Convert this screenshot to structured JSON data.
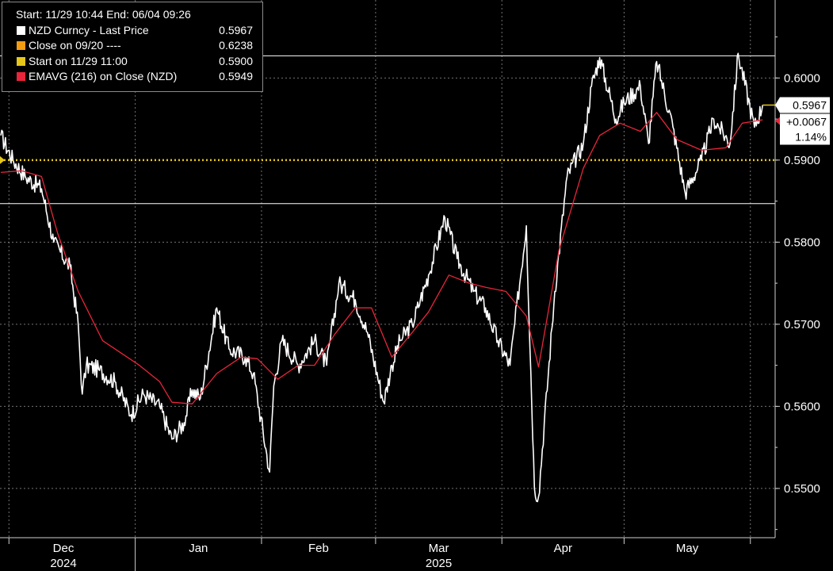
{
  "legend": {
    "header": "Start: 11/29 10:44 End: 06/04 09:26",
    "items": [
      {
        "label": "NZD Curncy - Last Price",
        "value": "0.5967",
        "color": "#ffffff"
      },
      {
        "label": "Close on 09/20 ----",
        "value": "0.6238",
        "color": "#f39c12"
      },
      {
        "label": "Start on 11/29 11:00",
        "value": "0.5900",
        "color": "#e6c619"
      },
      {
        "label": "EMAVG (216)  on Close (NZD)",
        "value": "0.5949",
        "color": "#e8253a"
      }
    ]
  },
  "last_box": {
    "price": "0.5967",
    "change": "+0.0067",
    "pct": "1.14%"
  },
  "chart_data": {
    "type": "line",
    "title": "",
    "ylim": [
      0.544,
      0.6095
    ],
    "y_ticks": [
      "0.5500",
      "0.5600",
      "0.5700",
      "0.5800",
      "0.5900",
      "0.6000"
    ],
    "x_months": [
      {
        "label": "Dec",
        "year": "2024"
      },
      {
        "label": "Jan",
        "year": ""
      },
      {
        "label": "Feb",
        "year": ""
      },
      {
        "label": "Mar",
        "year": "2025"
      },
      {
        "label": "Apr",
        "year": ""
      },
      {
        "label": "May",
        "year": ""
      }
    ],
    "hlines": [
      {
        "name": "upper_level",
        "value": 0.6027,
        "color": "#ffffff",
        "style": "solid"
      },
      {
        "name": "Start on 11/29 11:00",
        "value": 0.59,
        "color": "#e6c619",
        "style": "dotted"
      },
      {
        "name": "lower_level",
        "value": 0.5847,
        "color": "#ffffff",
        "style": "solid"
      }
    ],
    "series": [
      {
        "name": "NZD Curncy - Last Price",
        "color": "#ffffff",
        "x": [
          "11/29",
          "12/02",
          "12/05",
          "12/09",
          "12/12",
          "12/16",
          "12/18",
          "12/19",
          "12/20",
          "12/23",
          "12/27",
          "12/31",
          "01/03",
          "01/07",
          "01/10",
          "01/13",
          "01/15",
          "01/17",
          "01/21",
          "01/24",
          "01/28",
          "01/30",
          "02/03",
          "02/04",
          "02/06",
          "02/10",
          "02/14",
          "02/17",
          "02/20",
          "02/24",
          "02/27",
          "03/03",
          "03/05",
          "03/07",
          "03/10",
          "03/12",
          "03/14",
          "03/18",
          "03/21",
          "03/25",
          "03/28",
          "03/31",
          "04/03",
          "04/07",
          "04/09",
          "04/10",
          "04/14",
          "04/17",
          "04/21",
          "04/23",
          "04/25",
          "04/29",
          "05/01",
          "05/05",
          "05/07",
          "05/09",
          "05/13",
          "05/16",
          "05/20",
          "05/23",
          "05/27",
          "05/29",
          "06/02",
          "06/04"
        ],
        "values": [
          0.593,
          0.59,
          0.588,
          0.5865,
          0.58,
          0.577,
          0.57,
          0.5615,
          0.565,
          0.5645,
          0.563,
          0.559,
          0.5615,
          0.56,
          0.556,
          0.558,
          0.562,
          0.561,
          0.572,
          0.567,
          0.566,
          0.564,
          0.552,
          0.5625,
          0.568,
          0.565,
          0.568,
          0.565,
          0.575,
          0.573,
          0.569,
          0.5605,
          0.565,
          0.568,
          0.57,
          0.573,
          0.576,
          0.583,
          0.578,
          0.574,
          0.572,
          0.568,
          0.565,
          0.582,
          0.55,
          0.549,
          0.574,
          0.588,
          0.592,
          0.599,
          0.6025,
          0.595,
          0.597,
          0.599,
          0.592,
          0.602,
          0.594,
          0.586,
          0.59,
          0.595,
          0.592,
          0.603,
          0.594,
          0.5967
        ]
      },
      {
        "name": "EMAVG (216)  on Close (NZD)",
        "color": "#e8253a",
        "x": [
          "11/29",
          "12/04",
          "12/09",
          "12/13",
          "12/18",
          "12/24",
          "01/02",
          "01/07",
          "01/10",
          "01/15",
          "01/21",
          "01/27",
          "01/31",
          "02/05",
          "02/10",
          "02/14",
          "02/19",
          "02/24",
          "02/28",
          "03/05",
          "03/10",
          "03/14",
          "03/19",
          "03/24",
          "03/28",
          "04/02",
          "04/07",
          "04/10",
          "04/15",
          "04/21",
          "04/25",
          "04/30",
          "05/05",
          "05/09",
          "05/14",
          "05/20",
          "05/26",
          "05/30",
          "06/04"
        ],
        "values": [
          0.5885,
          0.5887,
          0.588,
          0.581,
          0.574,
          0.568,
          0.565,
          0.563,
          0.5605,
          0.5603,
          0.564,
          0.566,
          0.5658,
          0.5633,
          0.565,
          0.565,
          0.5688,
          0.572,
          0.572,
          0.566,
          0.569,
          0.5715,
          0.576,
          0.575,
          0.5745,
          0.574,
          0.571,
          0.5648,
          0.579,
          0.589,
          0.593,
          0.5945,
          0.5935,
          0.5958,
          0.5925,
          0.5912,
          0.5915,
          0.5945,
          0.5949
        ]
      }
    ]
  }
}
